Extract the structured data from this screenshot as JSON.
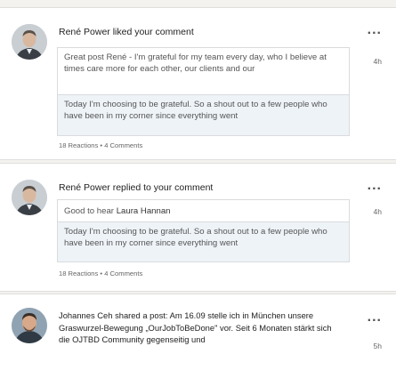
{
  "notifications": [
    {
      "title": "René Power liked your comment",
      "comment": "Great post René - I'm grateful for my team every day, who I believe at times care more for each other, our clients and our",
      "post": "Today I'm choosing to be grateful. So a shout out to a few people who have been in my corner since everything went",
      "stats": "18 Reactions • 4 Comments",
      "time": "4h",
      "more": "..."
    },
    {
      "title": "René Power replied to your comment",
      "comment_prefix": "Good to hear",
      "comment_mention": "Laura Hannan",
      "post": "Today I'm choosing to be grateful. So a shout out to a few people who have been in my corner since everything went",
      "stats": "18 Reactions • 4 Comments",
      "time": "4h",
      "more": "..."
    },
    {
      "text": "Johannes Ceh shared a post: Am 16.09 stelle ich in München unsere Graswurzel-Bewegung „OurJobToBeDone\" vor. Seit 6 Monaten stärkt sich die OJTBD Community gegenseitig und",
      "time": "5h",
      "more": "..."
    }
  ]
}
